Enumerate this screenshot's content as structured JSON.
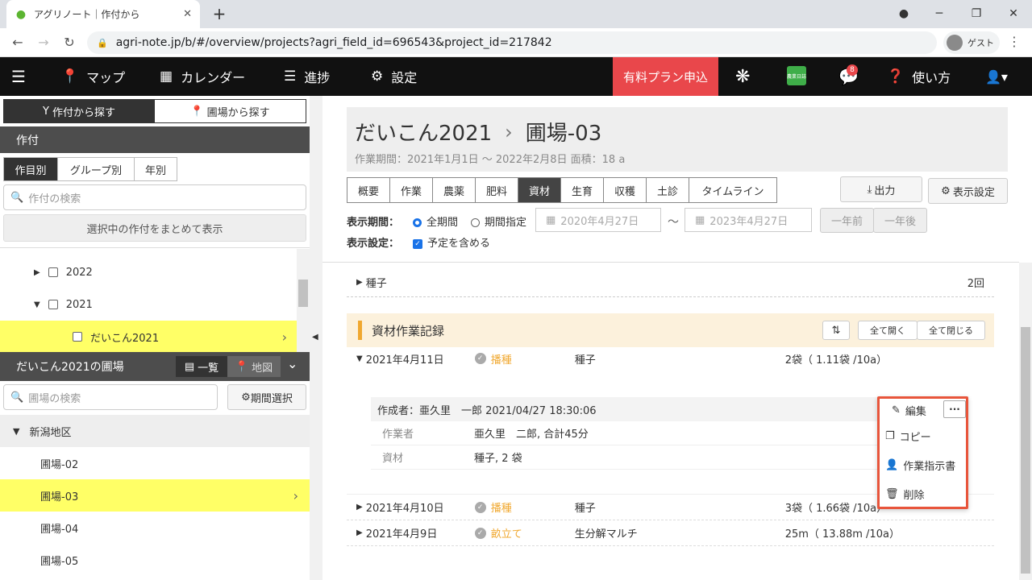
{
  "browser": {
    "tab_title": "アグリノート｜作付から",
    "url": "agri-note.jp/b/#/overview/projects?agri_field_id=696543&project_id=217842",
    "profile": "ゲスト"
  },
  "nav": {
    "map": "マップ",
    "calendar": "カレンダー",
    "progress": "進捗",
    "settings": "設定",
    "paid_plan": "有料プラン申込",
    "notif_count": "8",
    "help": "使い方",
    "app_icon_label": "農業日誌"
  },
  "sidebar": {
    "toggle": [
      "作付から探す",
      "圃場から探す"
    ],
    "crop_header": "作付",
    "subtabs": [
      "作目別",
      "グループ別",
      "年別"
    ],
    "crop_search_placeholder": "作付の検索",
    "show_selected": "選択中の作付をまとめて表示",
    "tree": [
      {
        "label": "2022",
        "arrow": "▶"
      },
      {
        "label": "2021",
        "arrow": "▼"
      },
      {
        "label": "だいこん2021",
        "arrow": ""
      }
    ],
    "fields_header": "だいこん2021の圃場",
    "view_list": "一覧",
    "view_map": "地図",
    "field_search_placeholder": "圃場の検索",
    "period_select": "期間選択",
    "region": "新潟地区",
    "fields": [
      "圃場-02",
      "圃場-03",
      "圃場-04",
      "圃場-05"
    ]
  },
  "main": {
    "crop": "だいこん2021",
    "field": "圃場-03",
    "meta": "作業期間：2021年1月1日 〜 2022年2月8日  面積：18 a",
    "tabs": [
      "概要",
      "作業",
      "農薬",
      "肥料",
      "資材",
      "生育",
      "収穫",
      "土診",
      "タイムライン"
    ],
    "export": "出力",
    "display_settings": "表示設定",
    "period_label": "表示期間：",
    "all_period": "全期間",
    "specify_period": "期間指定",
    "date_from": "2020年4月27日",
    "date_to": "2023年4月27日",
    "tilde": "〜",
    "prev_year": "一年前",
    "next_year": "一年後",
    "setting_label": "表示設定：",
    "include_plan": "予定を含める",
    "summary": {
      "name": "種子",
      "count": "2回"
    },
    "section_title": "資材作業記録",
    "expand_all": "全て開く",
    "collapse_all": "全て閉じる",
    "records": [
      {
        "date": "2021年4月11日",
        "type": "播種",
        "material": "種子",
        "amount": "2袋（ 1.11袋 /10a）",
        "arrow": "▼"
      },
      {
        "date": "2021年4月10日",
        "type": "播種",
        "material": "種子",
        "amount": "3袋（ 1.66袋 /10a）",
        "arrow": "▶"
      },
      {
        "date": "2021年4月9日",
        "type": "畝立て",
        "material": "生分解マルチ",
        "amount": "25m（ 13.88m /10a）",
        "arrow": "▶"
      }
    ],
    "detail": {
      "created": "作成者：亜久里　一郎  2021/04/27 18:30:06",
      "worker_label": "作業者",
      "worker": "亜久里　二郎, 合計45分",
      "material_label": "資材",
      "material": "種子, 2 袋"
    },
    "edit": "編集",
    "menu": [
      "コピー",
      "作業指示書",
      "削除"
    ]
  },
  "colors": {
    "accent": "#e9474b",
    "highlight": "#ffff66",
    "orange": "#f0a830"
  }
}
